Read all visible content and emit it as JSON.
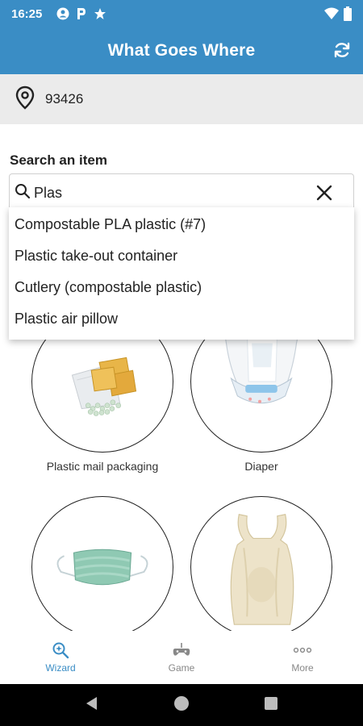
{
  "status_bar": {
    "time": "16:25",
    "icons": [
      "account-circle-icon",
      "parking-p-icon",
      "star-icon",
      "wifi-icon",
      "battery-icon"
    ]
  },
  "app_bar": {
    "title": "What Goes Where",
    "action_icon": "refresh-icon"
  },
  "location": {
    "icon": "location-pin-icon",
    "zip": "93426"
  },
  "search": {
    "label": "Search an item",
    "value": "Plas",
    "placeholder": "",
    "suggestions": [
      "Compostable PLA plastic (#7)",
      "Plastic take-out container",
      "Cutlery (compostable plastic)",
      "Plastic air pillow"
    ]
  },
  "items": [
    {
      "label": "Plastic mail packaging",
      "icon": "plastic-mail-packaging-image"
    },
    {
      "label": "Diaper",
      "icon": "diaper-image"
    },
    {
      "label": "",
      "icon": "face-mask-image"
    },
    {
      "label": "",
      "icon": "plastic-bag-image"
    }
  ],
  "bottom_nav": [
    {
      "label": "Wizard",
      "icon": "wizard-search-icon",
      "active": true
    },
    {
      "label": "Game",
      "icon": "game-controller-icon",
      "active": false
    },
    {
      "label": "More",
      "icon": "more-dots-icon",
      "active": false
    }
  ],
  "colors": {
    "primary": "#3a8dc5",
    "location_bg": "#ebebeb",
    "system_nav": "#000000"
  }
}
